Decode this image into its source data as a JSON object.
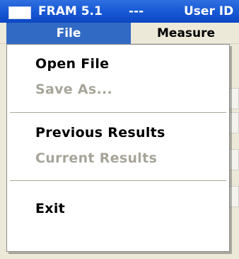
{
  "window": {
    "app_name": "FRAM 5.1",
    "title_separator": "---",
    "title_user": "User ID"
  },
  "menubar": {
    "items": [
      {
        "label": "File",
        "state": "open"
      },
      {
        "label": "Measure",
        "state": "normal"
      }
    ]
  },
  "file_menu": {
    "items": [
      {
        "label": "Open File",
        "enabled": true
      },
      {
        "label": "Save As...",
        "enabled": false
      },
      {
        "label": "Previous Results",
        "enabled": true
      },
      {
        "label": "Current Results",
        "enabled": false
      },
      {
        "label": "Exit",
        "enabled": true
      }
    ]
  },
  "colors": {
    "title_bar": "#0c47c4",
    "menu_highlight": "#316ac5",
    "menu_bar": "#ece9d8",
    "disabled_text": "#a7a59a"
  },
  "icons": {
    "app_icon": "window-icon"
  }
}
